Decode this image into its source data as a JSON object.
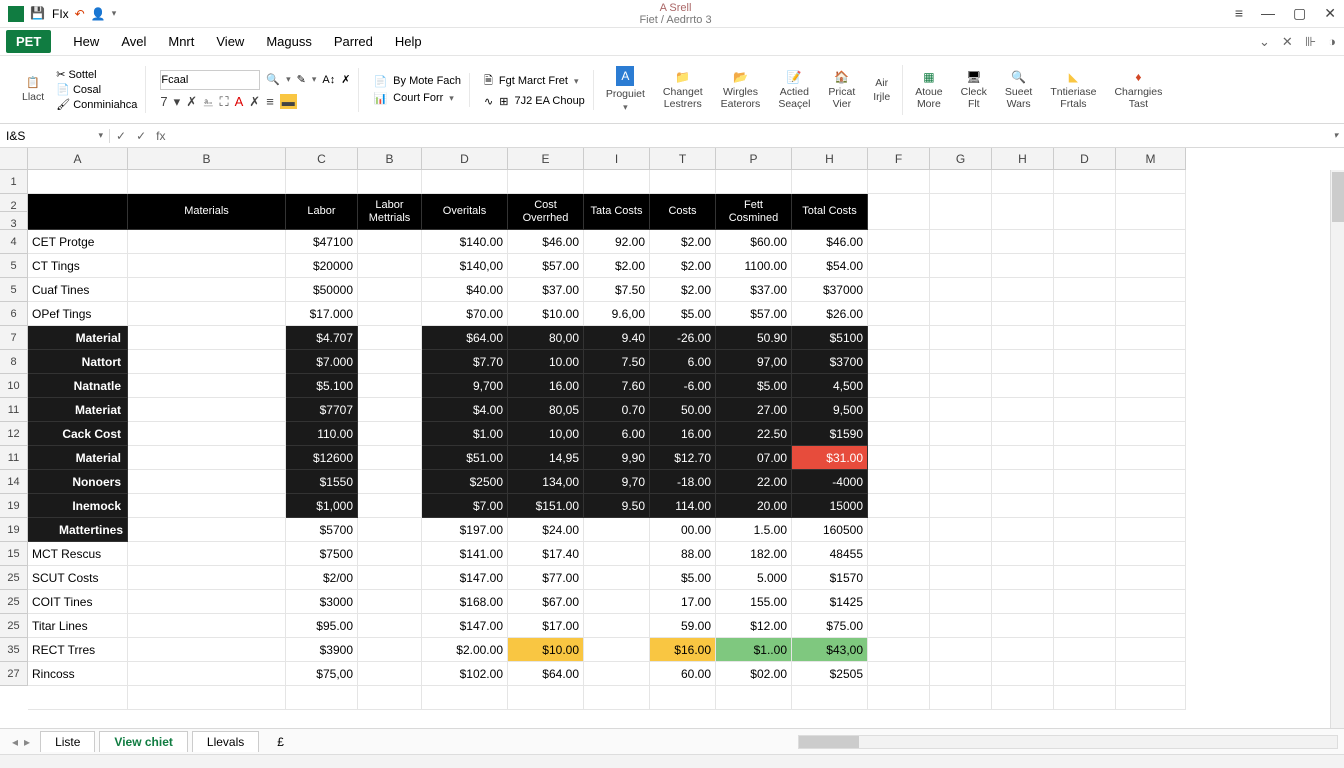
{
  "titlebar": {
    "app_hint": "A Srell",
    "doc_name": "Fiet / Aedrrto 3",
    "qat_label": "FIx",
    "win_min": "—",
    "win_max": "▢",
    "win_close": "✕",
    "win_bars": "≡"
  },
  "tabs": {
    "items": [
      "PET",
      "Hew",
      "Avel",
      "Mnrt",
      "View",
      "Maguss",
      "Parred",
      "Help"
    ],
    "active_index": 0
  },
  "ribbon": {
    "clipboard": {
      "big": "Llact",
      "opt1": "Sottel",
      "opt2": "Cosal",
      "opt3": "Conminiahca"
    },
    "fontname": "Fcaal",
    "fontsize": "7",
    "format_labels": [
      "By Mote Fach",
      "Fgt Marct Fret",
      "Court Forr",
      "7J2 EA Choup"
    ],
    "big_buttons": [
      {
        "label": "Proguiet",
        "sub": ""
      },
      {
        "label": "Changet",
        "sub": "Lestrers"
      },
      {
        "label": "Wirgles",
        "sub": "Eaterors"
      },
      {
        "label": "Actied",
        "sub": "Seaçel"
      },
      {
        "label": "Pricat",
        "sub": "Vier"
      },
      {
        "label": "Irjle",
        "sub": ""
      },
      {
        "label": "Atoue",
        "sub": "More"
      },
      {
        "label": "Cleck",
        "sub": "Flt"
      },
      {
        "label": "Sueet",
        "sub": "Wars"
      },
      {
        "label": "Tntieriase",
        "sub": "Frtals"
      },
      {
        "label": "Charngies",
        "sub": "Tast"
      }
    ],
    "air_label": "Air"
  },
  "fbar": {
    "namebox": "I&S",
    "fx": "fx"
  },
  "columns": {
    "letters": [
      "A",
      "B",
      "C",
      "B",
      "D",
      "E",
      "I",
      "T",
      "P",
      "H",
      "F",
      "G",
      "H",
      "D",
      "M"
    ],
    "widths": [
      100,
      158,
      72,
      64,
      86,
      76,
      66,
      66,
      76,
      76,
      62,
      62,
      62,
      62,
      70
    ]
  },
  "headers": {
    "A": "",
    "B": "Materials",
    "C": "Labor",
    "D": "Labor Mettrials",
    "E": "Overitals",
    "F": "Cost Overrhed",
    "G": "Tata Costs",
    "H": "Costs",
    "I": "Fett Cosmined",
    "J": "Total Costs"
  },
  "row_nums": [
    "1",
    "2",
    "3",
    "4",
    "5",
    "5",
    "6",
    "7",
    "8",
    "10",
    "11",
    "12",
    "11",
    "14",
    "19",
    "19",
    "15",
    "25",
    "25",
    "25",
    "35",
    "27"
  ],
  "rows": [
    {
      "a": "CET Protge",
      "c": "$47100",
      "e": "$140.00",
      "f": "$46.00",
      "g": "92.00",
      "h": "$2.00",
      "i": "$60.00",
      "j": "$46.00"
    },
    {
      "a": "CT Tings",
      "c": "$20000",
      "e": "$140,00",
      "f": "$57.00",
      "g": "$2.00",
      "h": "$2.00",
      "i": "1100.00",
      "j": "$54.00"
    },
    {
      "a": "Cuaf Tines",
      "c": "$50000",
      "e": "$40.00",
      "f": "$37.00",
      "g": "$7.50",
      "h": "$2.00",
      "i": "$37.00",
      "j": "$37000"
    },
    {
      "a": "OPef Tings",
      "c": "$17.000",
      "e": "$70.00",
      "f": "$10.00",
      "g": "9.6,00",
      "h": "$5.00",
      "i": "$57.00",
      "j": "$26.00"
    },
    {
      "a": "Material",
      "c": "$4.707",
      "e": "$64.00",
      "f": "80,00",
      "g": "9.40",
      "h": "-26.00",
      "i": "50.90",
      "j": "$5100",
      "dark": true
    },
    {
      "a": "Nattort",
      "c": "$7.000",
      "e": "$7.70",
      "f": "10.00",
      "g": "7.50",
      "h": "6.00",
      "i": "97,00",
      "j": "$3700",
      "dark": true
    },
    {
      "a": "Natnatle",
      "c": "$5.100",
      "e": "9,700",
      "f": "16.00",
      "g": "7.60",
      "h": "-6.00",
      "i": "$5.00",
      "j": "4,500",
      "dark": true
    },
    {
      "a": "Materiat",
      "c": "$7707",
      "e": "$4.00",
      "f": "80,05",
      "g": "0.70",
      "h": "50.00",
      "i": "27.00",
      "j": "9,500",
      "dark": true
    },
    {
      "a": "Cack Cost",
      "c": "110.00",
      "e": "$1.00",
      "f": "10,00",
      "g": "6.00",
      "h": "16.00",
      "i": "22.50",
      "j": "$1590",
      "dark": true
    },
    {
      "a": "Material",
      "c": "$12600",
      "e": "$51.00",
      "f": "14,95",
      "g": "9,90",
      "h": "$12.70",
      "i": "07.00",
      "j": "$31.00",
      "dark": true,
      "hl_h": "dk",
      "hl_j": "hlR"
    },
    {
      "a": "Nonoers",
      "c": "$1550",
      "e": "$2500",
      "f": "134,00",
      "g": "9,70",
      "h": "-18.00",
      "i": "22.00",
      "j": "-4000",
      "dark": true
    },
    {
      "a": "Inemock",
      "c": "$1,000",
      "e": "$7.00",
      "f": "$151.00",
      "g": "9.50",
      "h": "114.00",
      "i": "20.00",
      "j": "15000",
      "dark": true
    },
    {
      "a": "Mattertines",
      "c": "$5700",
      "e": "$197.00",
      "f": "$24.00",
      "g": "",
      "h": "00.00",
      "i": "1.5.00",
      "j": "160500"
    },
    {
      "a": "MCT Rescus",
      "c": "$7500",
      "e": "$141.00",
      "f": "$17.40",
      "g": "",
      "h": "88.00",
      "i": "182.00",
      "j": "48455"
    },
    {
      "a": "SCUT Costs",
      "c": "$2/00",
      "e": "$147.00",
      "f": "$77.00",
      "g": "",
      "h": "$5.00",
      "i": "5.000",
      "j": "$1570"
    },
    {
      "a": "COIT Tines",
      "c": "$3000",
      "e": "$168.00",
      "f": "$67.00",
      "g": "",
      "h": "17.00",
      "i": "155.00",
      "j": "$1425"
    },
    {
      "a": "Titar Lines",
      "c": "$95.00",
      "e": "$147.00",
      "f": "$17.00",
      "g": "",
      "h": "59.00",
      "i": "$12.00",
      "j": "$75.00"
    },
    {
      "a": "RECT Trres",
      "c": "$3900",
      "e": "$2.00.00",
      "f": "$10.00",
      "g": "",
      "h": "$16.00",
      "i": "$1..00",
      "j": "$43,00",
      "hl_f": "hlY",
      "hl_h": "hlY",
      "hl_i": "hlG",
      "hl_j": "hlG"
    },
    {
      "a": "Rincoss",
      "c": "$75,00",
      "e": "$102.00",
      "f": "$64.00",
      "g": "",
      "h": "60.00",
      "i": "$02.00",
      "j": "$2505"
    }
  ],
  "sheets": {
    "items": [
      "Liste",
      "View chiet",
      "Llevals"
    ],
    "active_index": 1,
    "extra": "£"
  }
}
